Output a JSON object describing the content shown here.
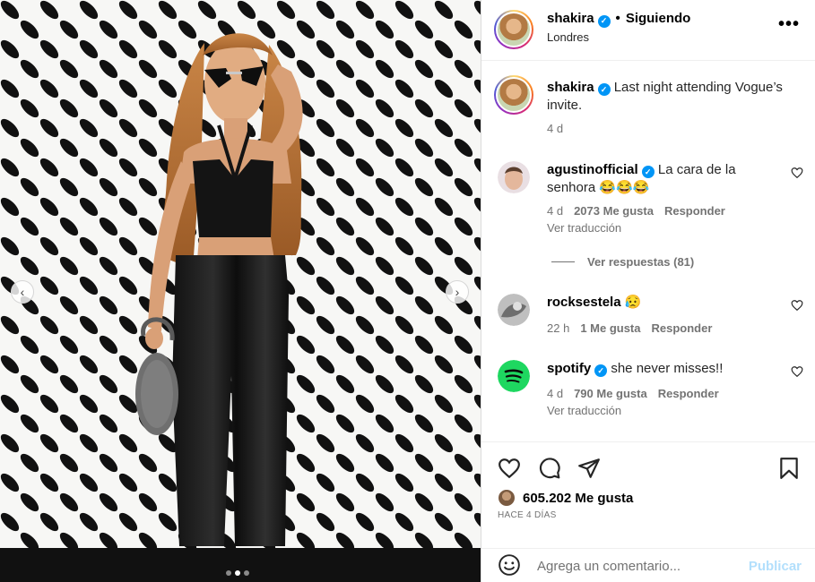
{
  "post": {
    "username": "shakira",
    "follow_status": "Siguiendo",
    "separator": "•",
    "location": "Londres",
    "more_label": "•••",
    "caption_text": "Last night attending Vogue’s invite.",
    "caption_time": "4 d",
    "likes_text": "605.202 Me gusta",
    "time_ago": "HACE 4 DÍAS",
    "carousel": {
      "prev_label": "‹",
      "next_label": "›",
      "dots": 3,
      "active_dot": 1
    }
  },
  "comments": [
    {
      "username": "agustinofficial",
      "verified": true,
      "text": "La cara de la senhora 😂😂😂",
      "time": "4 d",
      "likes": "2073 Me gusta",
      "reply": "Responder",
      "translate": "Ver traducción",
      "view_replies": "Ver respuestas (81)"
    },
    {
      "username": "rocksestela",
      "verified": false,
      "text": "😥",
      "time": "22 h",
      "likes": "1 Me gusta",
      "reply": "Responder"
    },
    {
      "username": "spotify",
      "verified": true,
      "text": "she never misses!!",
      "time": "4 d",
      "likes": "790 Me gusta",
      "reply": "Responder",
      "translate": "Ver traducción"
    }
  ],
  "composer": {
    "placeholder": "Agrega un comentario...",
    "publish_label": "Publicar"
  },
  "colors": {
    "verified": "#0095f6",
    "spotify": "#1ed760",
    "publish_disabled": "#b2dffc",
    "muted": "#737373"
  },
  "icons": [
    "heart-icon",
    "comment-icon",
    "share-icon",
    "bookmark-icon",
    "emoji-icon",
    "more-icon"
  ]
}
